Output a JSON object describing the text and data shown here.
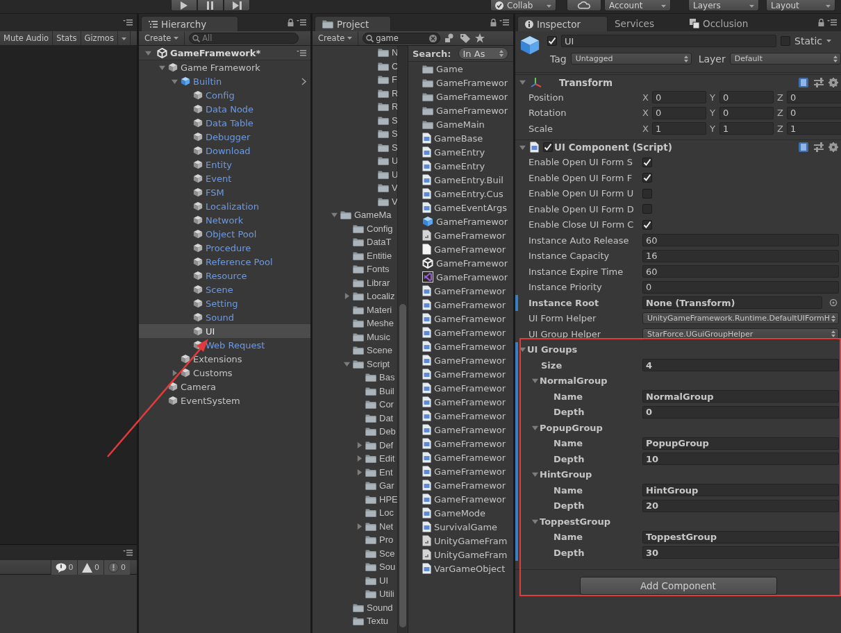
{
  "toolbar": {
    "play_controls": [
      {
        "kind": "play"
      },
      {
        "kind": "pause"
      },
      {
        "kind": "step"
      }
    ],
    "collab": "Collab",
    "account": "Account",
    "layers": "Layers",
    "layout": "Layout"
  },
  "game_view": {
    "buttons": [
      "Mute Audio",
      "Stats",
      "Gizmos"
    ]
  },
  "console": {
    "counts": [
      {
        "kind": "info",
        "count": "0"
      },
      {
        "kind": "warning",
        "count": "0"
      },
      {
        "kind": "error",
        "count": "0"
      }
    ]
  },
  "hierarchy": {
    "tab": "Hierarchy",
    "create": "Create",
    "search_placeholder": "All",
    "scene": {
      "label": "GameFramework*",
      "expanded": true,
      "children": [
        {
          "label": "Game Framework",
          "kind": "object",
          "expanded": true,
          "selected": false,
          "children": [
            {
              "label": "Builtin",
              "kind": "prefab_root",
              "expanded": true,
              "selected": false,
              "children": [
                {
                  "label": "Config",
                  "kind": "prefab_child",
                  "selected": false
                },
                {
                  "label": "Data Node",
                  "kind": "prefab_child",
                  "selected": false
                },
                {
                  "label": "Data Table",
                  "kind": "prefab_child",
                  "selected": false
                },
                {
                  "label": "Debugger",
                  "kind": "prefab_child",
                  "selected": false
                },
                {
                  "label": "Download",
                  "kind": "prefab_child",
                  "selected": false
                },
                {
                  "label": "Entity",
                  "kind": "prefab_child",
                  "selected": false
                },
                {
                  "label": "Event",
                  "kind": "prefab_child",
                  "selected": false
                },
                {
                  "label": "FSM",
                  "kind": "prefab_child",
                  "selected": false
                },
                {
                  "label": "Localization",
                  "kind": "prefab_child",
                  "selected": false
                },
                {
                  "label": "Network",
                  "kind": "prefab_child",
                  "selected": false
                },
                {
                  "label": "Object Pool",
                  "kind": "prefab_child",
                  "selected": false
                },
                {
                  "label": "Procedure",
                  "kind": "prefab_child",
                  "selected": false
                },
                {
                  "label": "Reference Pool",
                  "kind": "prefab_child",
                  "selected": false
                },
                {
                  "label": "Resource",
                  "kind": "prefab_child",
                  "selected": false
                },
                {
                  "label": "Scene",
                  "kind": "prefab_child",
                  "selected": false
                },
                {
                  "label": "Setting",
                  "kind": "prefab_child",
                  "selected": false
                },
                {
                  "label": "Sound",
                  "kind": "prefab_child",
                  "selected": false
                },
                {
                  "label": "UI",
                  "kind": "prefab_child",
                  "selected": true
                },
                {
                  "label": "Web Request",
                  "kind": "prefab_child",
                  "selected": false
                }
              ]
            },
            {
              "label": "Extensions",
              "kind": "object",
              "selected": false
            },
            {
              "label": "Customs",
              "kind": "object",
              "expanded": false,
              "selected": false
            }
          ]
        },
        {
          "label": "Camera",
          "kind": "object",
          "selected": false
        },
        {
          "label": "EventSystem",
          "kind": "object",
          "selected": false
        }
      ]
    }
  },
  "project": {
    "tab": "Project",
    "create": "Create",
    "search_value": "game",
    "search_label": "Search:",
    "search_scope": "In As",
    "scrolled_branch": [
      "N",
      "C",
      "F",
      "R",
      "R",
      "S",
      "S",
      "S",
      "U",
      "U",
      "V",
      "V"
    ],
    "folders": [
      {
        "label": "GameMa",
        "expanded": true,
        "children": [
          {
            "label": "Config"
          },
          {
            "label": "DataT"
          },
          {
            "label": "Entitie"
          },
          {
            "label": "Fonts"
          },
          {
            "label": "Librar"
          },
          {
            "label": "Localiz",
            "expanded": false
          },
          {
            "label": "Materi"
          },
          {
            "label": "Meshe"
          },
          {
            "label": "Music"
          },
          {
            "label": "Scene"
          },
          {
            "label": "Script",
            "expanded": true,
            "children": [
              {
                "label": "Bas"
              },
              {
                "label": "Buil"
              },
              {
                "label": "Cor"
              },
              {
                "label": "Dat"
              },
              {
                "label": "Deb"
              },
              {
                "label": "Def",
                "expanded": false
              },
              {
                "label": "Edit",
                "expanded": false
              },
              {
                "label": "Ent",
                "expanded": false
              },
              {
                "label": "Gar"
              },
              {
                "label": "HPE"
              },
              {
                "label": "Loc"
              },
              {
                "label": "Net",
                "expanded": false
              },
              {
                "label": "Pro"
              },
              {
                "label": "Sce"
              },
              {
                "label": "Sou"
              },
              {
                "label": "UI"
              },
              {
                "label": "Utili"
              }
            ]
          },
          {
            "label": "Sound"
          },
          {
            "label": "Textu"
          }
        ]
      }
    ],
    "results": [
      {
        "name": "Game",
        "kind": "folder"
      },
      {
        "name": "GameFramewor",
        "kind": "folder"
      },
      {
        "name": "GameFramewor",
        "kind": "folder"
      },
      {
        "name": "GameFramewor",
        "kind": "folder"
      },
      {
        "name": "GameMain",
        "kind": "folder"
      },
      {
        "name": "GameBase",
        "kind": "script"
      },
      {
        "name": "GameEntry",
        "kind": "script"
      },
      {
        "name": "GameEntry",
        "kind": "script"
      },
      {
        "name": "GameEntry.Buil",
        "kind": "script"
      },
      {
        "name": "GameEntry.Cus",
        "kind": "script"
      },
      {
        "name": "GameEventArgs",
        "kind": "script"
      },
      {
        "name": "GameFramewor",
        "kind": "prefab"
      },
      {
        "name": "GameFramewor",
        "kind": "asset"
      },
      {
        "name": "GameFramewor",
        "kind": "text"
      },
      {
        "name": "GameFramewor",
        "kind": "scene"
      },
      {
        "name": "GameFramewor",
        "kind": "solution"
      },
      {
        "name": "GameFramewor",
        "kind": "script"
      },
      {
        "name": "GameFramewor",
        "kind": "script"
      },
      {
        "name": "GameFramewor",
        "kind": "script"
      },
      {
        "name": "GameFramewor",
        "kind": "script"
      },
      {
        "name": "GameFramewor",
        "kind": "script"
      },
      {
        "name": "GameFramewor",
        "kind": "script"
      },
      {
        "name": "GameFramewor",
        "kind": "script"
      },
      {
        "name": "GameFramewor",
        "kind": "script"
      },
      {
        "name": "GameFramewor",
        "kind": "script"
      },
      {
        "name": "GameFramewor",
        "kind": "script"
      },
      {
        "name": "GameFramewor",
        "kind": "script"
      },
      {
        "name": "GameFramewor",
        "kind": "script"
      },
      {
        "name": "GameFramewor",
        "kind": "script"
      },
      {
        "name": "GameFramewor",
        "kind": "script"
      },
      {
        "name": "GameFramewor",
        "kind": "script"
      },
      {
        "name": "GameFramewor",
        "kind": "script"
      },
      {
        "name": "GameMode",
        "kind": "script"
      },
      {
        "name": "SurvivalGame",
        "kind": "script"
      },
      {
        "name": "UnityGameFram",
        "kind": "asset"
      },
      {
        "name": "UnityGameFram",
        "kind": "asset"
      },
      {
        "name": "VarGameObject",
        "kind": "script"
      }
    ]
  },
  "inspector": {
    "tabs": [
      {
        "label": "Inspector",
        "kind": "info",
        "selected": true
      },
      {
        "label": "Services",
        "kind": "plain",
        "selected": false
      },
      {
        "label": "Occlusion",
        "kind": "occlusion",
        "selected": false
      }
    ],
    "object": {
      "active": true,
      "name": "UI",
      "static": false,
      "static_label": "Static",
      "tag_label": "Tag",
      "tag": "Untagged",
      "layer_label": "Layer",
      "layer": "Default"
    },
    "transform": {
      "title": "Transform",
      "expanded": true,
      "rows": [
        {
          "label": "Position",
          "axes": [
            {
              "axis": "X",
              "value": "0"
            },
            {
              "axis": "Y",
              "value": "0"
            },
            {
              "axis": "Z",
              "value": "0"
            }
          ]
        },
        {
          "label": "Rotation",
          "axes": [
            {
              "axis": "X",
              "value": "0"
            },
            {
              "axis": "Y",
              "value": "0"
            },
            {
              "axis": "Z",
              "value": "0"
            }
          ]
        },
        {
          "label": "Scale",
          "axes": [
            {
              "axis": "X",
              "value": "1"
            },
            {
              "axis": "Y",
              "value": "1"
            },
            {
              "axis": "Z",
              "value": "1"
            }
          ]
        }
      ]
    },
    "script": {
      "title": "UI Component (Script)",
      "expanded": true,
      "enabled": true,
      "rows": [
        {
          "kind": "toggle",
          "label": "Enable Open UI Form S",
          "checked": true,
          "modified": false
        },
        {
          "kind": "toggle",
          "label": "Enable Open UI Form F",
          "checked": true,
          "modified": false
        },
        {
          "kind": "toggle",
          "label": "Enable Open UI Form U",
          "checked": false,
          "modified": false
        },
        {
          "kind": "toggle",
          "label": "Enable Open UI Form D",
          "checked": false,
          "modified": false
        },
        {
          "kind": "toggle",
          "label": "Enable Close UI Form C",
          "checked": true,
          "modified": false
        },
        {
          "kind": "number",
          "label": "Instance Auto Release",
          "value": "60",
          "modified": false
        },
        {
          "kind": "number",
          "label": "Instance Capacity",
          "value": "16",
          "modified": false
        },
        {
          "kind": "number",
          "label": "Instance Expire Time",
          "value": "60",
          "modified": false
        },
        {
          "kind": "number",
          "label": "Instance Priority",
          "value": "0",
          "modified": false
        },
        {
          "kind": "object",
          "label": "Instance Root",
          "value": "None (Transform)",
          "modified": true
        },
        {
          "kind": "dropdown",
          "label": "UI Form Helper",
          "value": "UnityGameFramework.Runtime.DefaultUIFormH",
          "modified": false
        },
        {
          "kind": "dropdown",
          "label": "UI Group Helper",
          "value": "StarForce.UGuiGroupHelper",
          "modified": false
        }
      ],
      "ui_groups": {
        "label": "UI Groups",
        "expanded": true,
        "size_label": "Size",
        "size": "4",
        "groups": [
          {
            "title": "NormalGroup",
            "expanded": true,
            "fields": [
              {
                "label": "Name",
                "value": "NormalGroup"
              },
              {
                "label": "Depth",
                "value": "0"
              }
            ]
          },
          {
            "title": "PopupGroup",
            "expanded": true,
            "fields": [
              {
                "label": "Name",
                "value": "PopupGroup"
              },
              {
                "label": "Depth",
                "value": "10"
              }
            ]
          },
          {
            "title": "HintGroup",
            "expanded": true,
            "fields": [
              {
                "label": "Name",
                "value": "HintGroup"
              },
              {
                "label": "Depth",
                "value": "20"
              }
            ]
          },
          {
            "title": "ToppestGroup",
            "expanded": true,
            "fields": [
              {
                "label": "Name",
                "value": "ToppestGroup"
              },
              {
                "label": "Depth",
                "value": "30"
              }
            ]
          }
        ]
      }
    },
    "add_component": "Add Component"
  }
}
